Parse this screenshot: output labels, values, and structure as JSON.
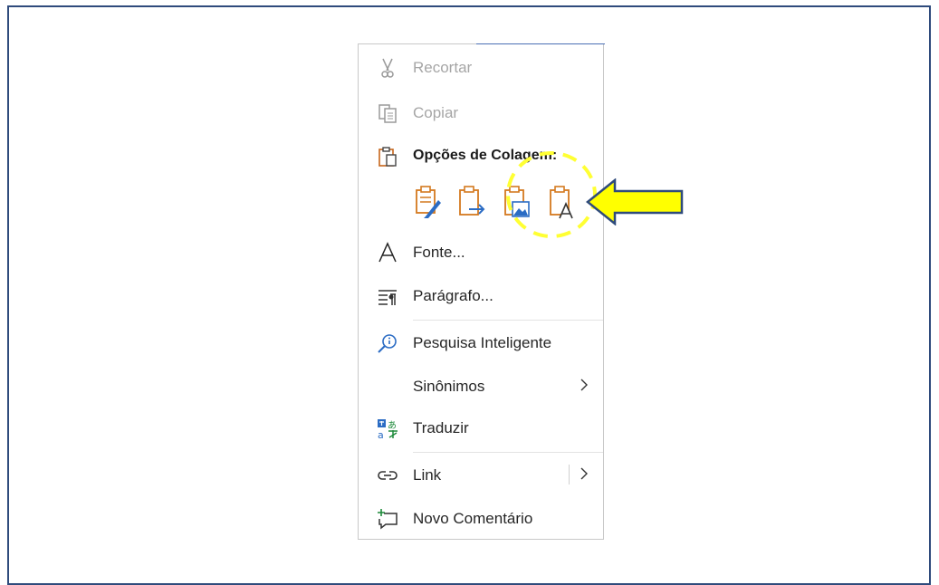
{
  "menu": {
    "cut": {
      "label": "Recortar",
      "icon": "scissors-icon",
      "disabled": true
    },
    "copy": {
      "label": "Copiar",
      "icon": "copy-icon",
      "disabled": true
    },
    "paste_options": {
      "label": "Opções de Colagem:",
      "icon": "clipboard-icon",
      "buttons": [
        {
          "name": "keep-source-formatting",
          "icon": "paste-keep-formatting-icon"
        },
        {
          "name": "merge-formatting",
          "icon": "paste-merge-formatting-icon"
        },
        {
          "name": "picture",
          "icon": "paste-picture-icon"
        },
        {
          "name": "keep-text-only",
          "icon": "paste-text-only-icon"
        }
      ]
    },
    "font": {
      "label": "Fonte...",
      "icon": "font-icon"
    },
    "paragraph": {
      "label": "Parágrafo...",
      "icon": "paragraph-icon"
    },
    "smart_lookup": {
      "label": "Pesquisa Inteligente",
      "icon": "smart-lookup-icon"
    },
    "synonyms": {
      "label": "Sinônimos",
      "submenu": true
    },
    "translate": {
      "label": "Traduzir",
      "icon": "translate-icon"
    },
    "link": {
      "label": "Link",
      "icon": "link-icon",
      "submenu": true
    },
    "new_comment": {
      "label": "Novo Comentário",
      "icon": "new-comment-icon"
    }
  },
  "annotation": {
    "color": "#ffff00",
    "outline": "#2f4b7c"
  }
}
